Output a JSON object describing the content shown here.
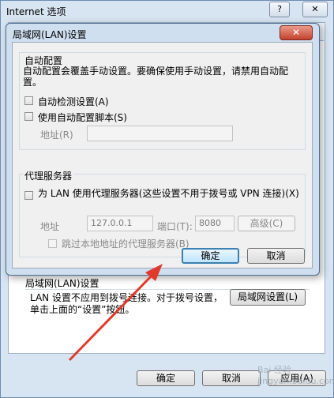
{
  "outer_window": {
    "title": "Internet 选项",
    "help_button": "?",
    "close_button": "✕",
    "lan_section_title": "局域网(LAN)设置",
    "lan_description": "LAN 设置不应用到拨号连接。对于拨号设置，单击上面的“设置”按钮。",
    "lan_settings_button": "局域网设置(L)",
    "ok_button": "确定",
    "cancel_button": "取消",
    "apply_button": "应用(A)"
  },
  "dialog": {
    "title": "局域网(LAN)设置",
    "close_button": "✕",
    "auto_config": {
      "group_title": "自动配置",
      "description": "自动配置会覆盖手动设置。要确保使用手动设置，请禁用自动配置。",
      "auto_detect_label": "自动检测设置(A)",
      "auto_detect_checked": false,
      "use_script_label": "使用自动配置脚本(S)",
      "use_script_checked": false,
      "address_label": "地址(R)",
      "address_value": ""
    },
    "proxy": {
      "group_title": "代理服务器",
      "use_proxy_label": "为 LAN 使用代理服务器(这些设置不用于拨号或 VPN 连接)(X)",
      "use_proxy_checked": false,
      "address_label": "地址",
      "address_value": "127.0.0.1",
      "port_label": "端口(T):",
      "port_value": "8080",
      "advanced_button": "高级(C)",
      "bypass_label": "跳过本地地址的代理服务器(B)",
      "bypass_checked": false
    },
    "ok_button": "确定",
    "cancel_button": "取消"
  },
  "annotation": {
    "arrow_color": "#e03a2c"
  },
  "watermark": "Bai 经验 jingyan.baidu.com"
}
